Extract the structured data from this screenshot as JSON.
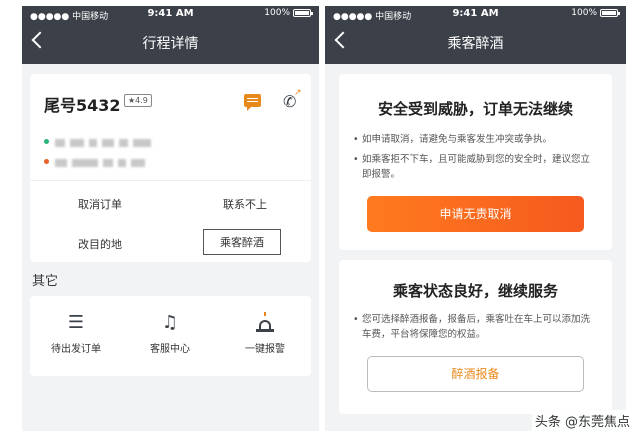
{
  "status": {
    "signal": "●●●●● 中国移动",
    "time": "9:41 AM",
    "battery": "100%"
  },
  "left": {
    "nav_title": "行程详情",
    "driver": {
      "tail": "尾号5432",
      "rating": "★4.9"
    },
    "actions": {
      "cancel": "取消订单",
      "unreachable": "联系不上",
      "change_dest": "改目的地",
      "drunk": "乘客醉酒"
    },
    "section_other": "其它",
    "other": [
      {
        "label": "待出发订单",
        "icon": "order-list-icon"
      },
      {
        "label": "客服中心",
        "icon": "headset-icon"
      },
      {
        "label": "一键报警",
        "icon": "siren-icon"
      }
    ],
    "colors": {
      "origin": "#2bb37b",
      "destination": "#e8612c"
    }
  },
  "right": {
    "nav_title": "乘客醉酒",
    "danger": {
      "title": "安全受到威胁，订单无法继续",
      "bullets": [
        "如申请取消，请避免与乘客发生冲突或争执。",
        "如乘客拒不下车，且可能威胁到您的安全时，建议您立即报警。"
      ],
      "button": "申请无责取消"
    },
    "ok": {
      "title": "乘客状态良好，继续服务",
      "bullets": [
        "您可选择醉酒报备，报备后，乘客吐在车上可以添加洗车费，平台将保障您的权益。"
      ],
      "button": "醉酒报备"
    }
  },
  "watermark": "头条 @东莞焦点",
  "colors": {
    "navbar": "#3b4049",
    "accent": "#e8891c",
    "button": "#f55a1e"
  }
}
